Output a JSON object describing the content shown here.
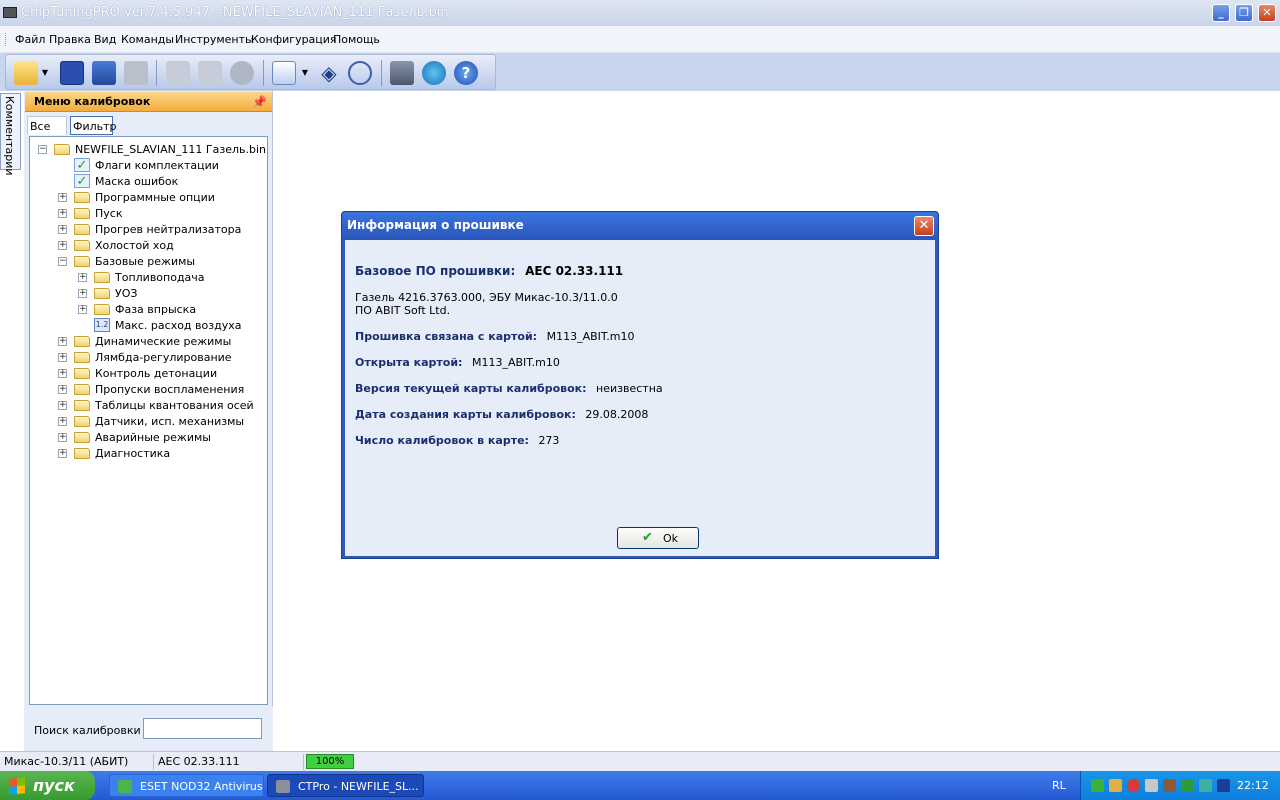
{
  "window": {
    "title": "ChipTuningPRO ver.7.4.5.947 - NEWFILE_SLAVIAN_111 Газель.bin"
  },
  "menu": [
    "Файл",
    "Правка",
    "Вид",
    "Команды",
    "Инструменты",
    "Конфигурация",
    "Помощь"
  ],
  "sidetab": {
    "label": "Комментарии"
  },
  "panel": {
    "title": "Меню калибровок",
    "tabs": {
      "all": "Все",
      "filter": "Фильтр"
    },
    "tree": [
      {
        "label": "NEWFILE_SLAVIAN_111 Газель.bin",
        "icon": "folder-open-icon"
      },
      {
        "label": "Флаги комплектации",
        "icon": "checkmark-icon"
      },
      {
        "label": "Маска ошибок",
        "icon": "checkmark-icon"
      },
      {
        "label": "Программные опции",
        "icon": "folder-icon"
      },
      {
        "label": "Пуск",
        "icon": "folder-icon"
      },
      {
        "label": "Прогрев нейтрализатора",
        "icon": "folder-icon"
      },
      {
        "label": "Холостой ход",
        "icon": "folder-icon"
      },
      {
        "label": "Базовые режимы",
        "icon": "folder-open-icon"
      },
      {
        "label": "Топливоподача",
        "icon": "folder-icon"
      },
      {
        "label": "УОЗ",
        "icon": "folder-icon"
      },
      {
        "label": "Фаза впрыска",
        "icon": "folder-icon"
      },
      {
        "label": "Макс. расход воздуха",
        "icon": "value-icon",
        "icon_text": "1.2"
      },
      {
        "label": "Динамические режимы",
        "icon": "folder-icon"
      },
      {
        "label": "Лямбда-регулирование",
        "icon": "folder-icon"
      },
      {
        "label": "Контроль детонации",
        "icon": "folder-icon"
      },
      {
        "label": "Пропуски воспламенения",
        "icon": "folder-icon"
      },
      {
        "label": "Таблицы квантования осей",
        "icon": "folder-icon"
      },
      {
        "label": "Датчики, исп. механизмы",
        "icon": "folder-icon"
      },
      {
        "label": "Аварийные режимы",
        "icon": "folder-icon"
      },
      {
        "label": "Диагностика",
        "icon": "folder-icon"
      }
    ],
    "search_label": "Поиск калибровки",
    "search_value": ""
  },
  "dialog": {
    "title": "Информация о прошивке",
    "base_label": "Базовое ПО прошивки:",
    "base_value": "AEC 02.33.111",
    "desc_line1": "Газель 4216.3763.000, ЭБУ Микас-10.3/11.0.0",
    "desc_line2": "ПО ABIT Soft Ltd.",
    "linked_label": "Прошивка связана с картой:",
    "linked_value": "M113_ABIT.m10",
    "opened_label": "Открыта картой:",
    "opened_value": "M113_ABIT.m10",
    "version_label": "Версия текущей карты калибровок:",
    "version_value": "неизвестна",
    "date_label": "Дата создания карты калибровок:",
    "date_value": "29.08.2008",
    "count_label": "Число калибровок в карте:",
    "count_value": "273",
    "ok_label": "Ok"
  },
  "status": {
    "ecu": "Микас-10.3/11 (АБИТ)",
    "firmware": "AEC 02.33.111",
    "progress": "100%"
  },
  "taskbar": {
    "start": "пуск",
    "tasks": [
      "ESET NOD32 Antivirus",
      "CTPro - NEWFILE_SL..."
    ],
    "lang": "RL",
    "clock": "22:12"
  },
  "colors": {
    "accent": "#2f5ab8",
    "panel_header": "#f4ac3c",
    "progress": "#3fcf3f"
  }
}
